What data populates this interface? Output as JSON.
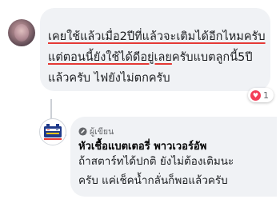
{
  "comment": {
    "line1": "เคยใช้แล้วเมื่อ2ปีที่แล้วจะเติมได้อีกไหมครับ",
    "line2_highlight": "แต่ตอนนี้ยังใช้ได้ดีอยู่เลย",
    "line2_rest": "ครับแบตลูกนี้5ปี",
    "line3": "แล้วครับ ไฟยังไม่ตกครับ",
    "reaction_count": "1"
  },
  "reply": {
    "author_badge": "ผู้เขียน",
    "author_name": "หัวเชื้อแบตเตอรี่ พาวเวอร์อัพ",
    "line1": "ถ้าสตาร์ทได้ปกติ ยังไม่ต้องเติมนะ",
    "line2": "ครับ แค่เช็คน้ำกลั่นก็พอแล้วครับ"
  },
  "icons": {
    "reaction": "heart-reaction-icon",
    "badge": "pencil-icon",
    "page_avatar": "battery-logo-icon"
  },
  "colors": {
    "underline": "#e53935",
    "bubble": "#f0f2f5",
    "heart": "#f33e58"
  }
}
